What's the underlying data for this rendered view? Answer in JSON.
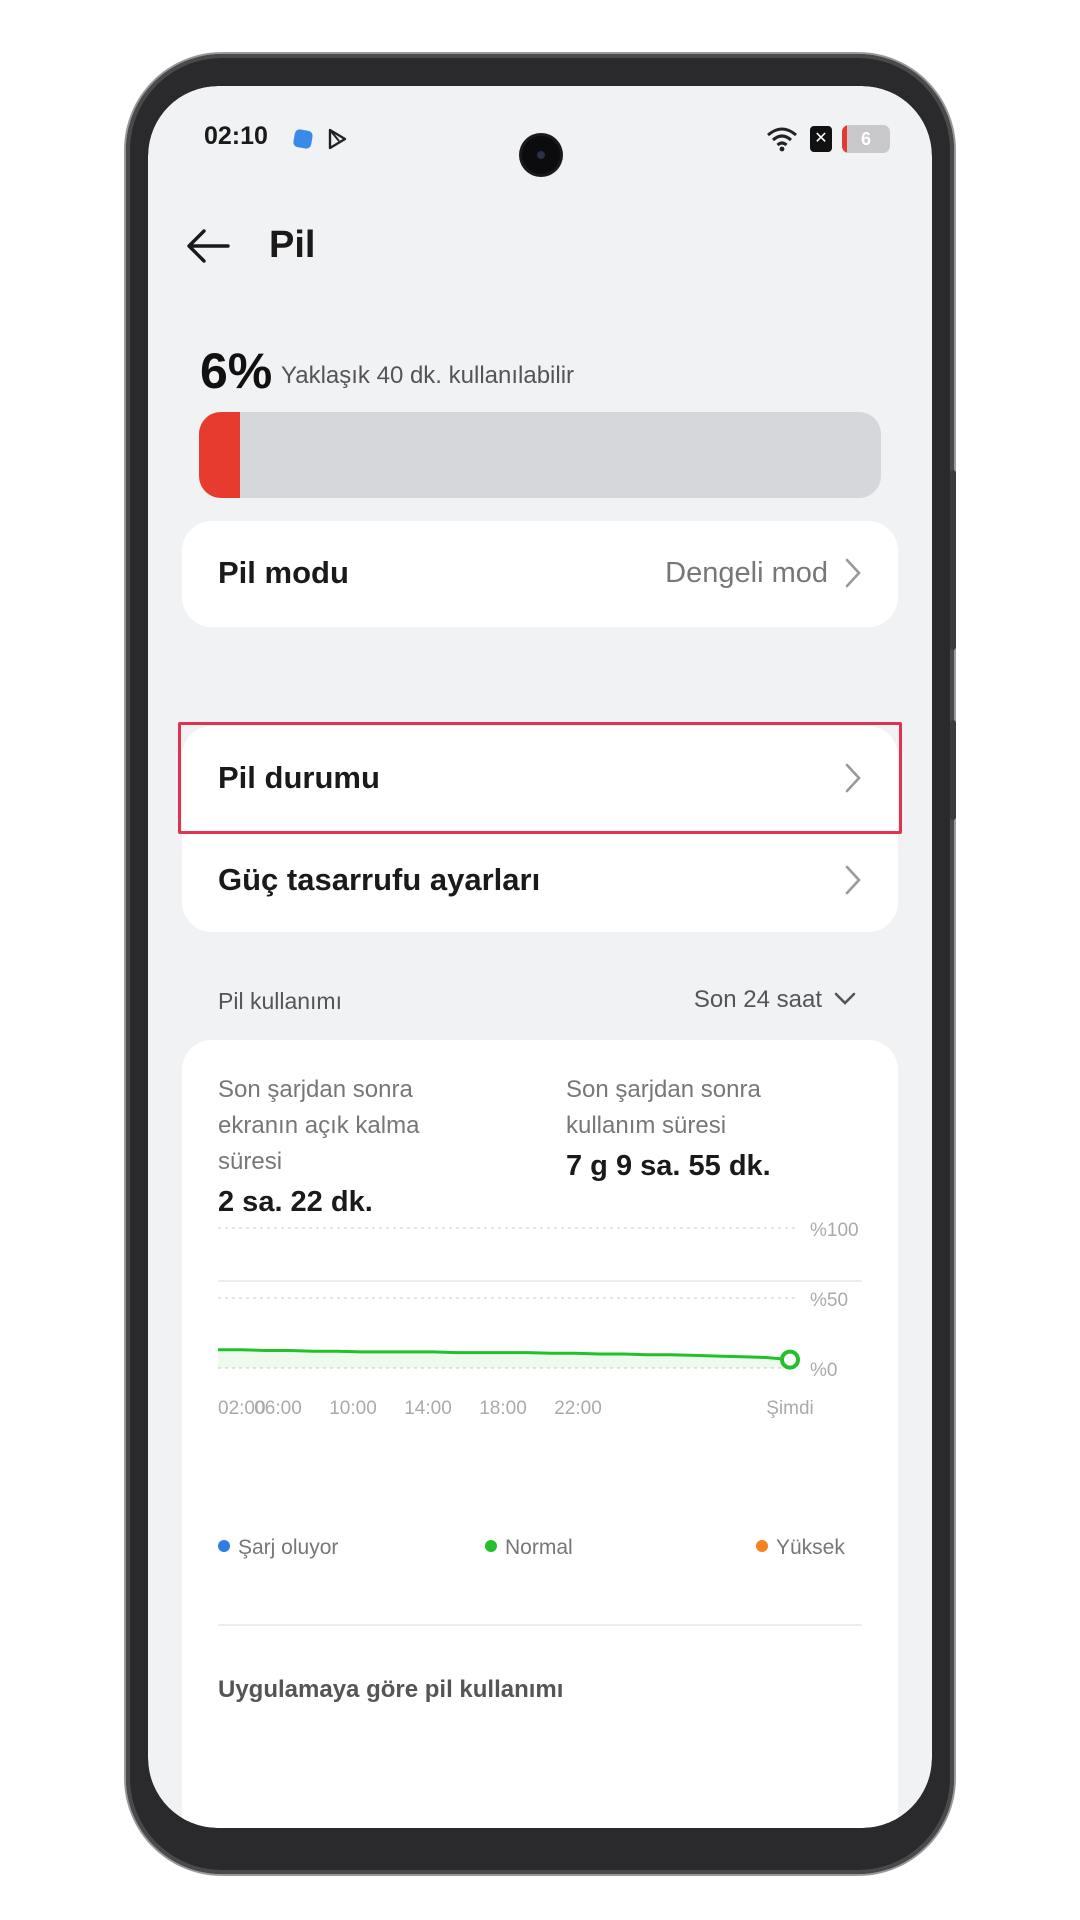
{
  "status_bar": {
    "time": "02:10",
    "battery_level": "6",
    "battery_fill_fraction": 0.06
  },
  "header": {
    "title": "Pil"
  },
  "battery": {
    "percent": "6%",
    "remaining": "Yaklaşık 40 dk. kullanılabilir",
    "level_fraction": 0.06
  },
  "mode_row": {
    "label": "Pil modu",
    "value": "Dengeli mod"
  },
  "rows": [
    {
      "label": "Pil durumu"
    },
    {
      "label": "Güç tasarrufu ayarları"
    }
  ],
  "usage": {
    "title": "Pil kullanımı",
    "range": "Son 24 saat",
    "screen_on_label": "Son şarjdan sonra ekranın açık kalma süresi",
    "screen_on_value": "2 sa. 22 dk.",
    "usage_label": "Son şarjdan sonra kullanım süresi",
    "usage_value": "7 g 9 sa. 55 dk.",
    "by_app_title": "Uygulamaya göre pil kullanımı"
  },
  "colors": {
    "charging": "#2f7ce6",
    "normal": "#22c02a",
    "high": "#f5811f",
    "accent_red": "#e63b2e",
    "highlight": "#e3324f"
  },
  "chart_data": {
    "type": "line",
    "x_labels": [
      "02:00",
      "06:00",
      "10:00",
      "14:00",
      "18:00",
      "22:00",
      "Şimdi"
    ],
    "y_labels": [
      "%100",
      "%50",
      "%0"
    ],
    "ylim": [
      0,
      100
    ],
    "series": [
      {
        "name": "Normal",
        "color": "#22c02a",
        "x": [
          0,
          1,
          2,
          3,
          4,
          5,
          6,
          7,
          8,
          9,
          10,
          11,
          12,
          13,
          14,
          15,
          16,
          17,
          18,
          19,
          20,
          21,
          22,
          23,
          24
        ],
        "values": [
          13,
          13,
          12.5,
          12.5,
          12,
          12,
          11.5,
          11.5,
          11.5,
          11.5,
          11,
          11,
          11,
          11,
          10.5,
          10.5,
          10,
          10,
          9.5,
          9.5,
          9,
          8.5,
          8,
          7.5,
          6
        ]
      }
    ],
    "legend": [
      {
        "name": "Şarj oluyor",
        "color": "#2f7ce6"
      },
      {
        "name": "Normal",
        "color": "#22c02a"
      },
      {
        "name": "Yüksek",
        "color": "#f5811f"
      }
    ]
  }
}
